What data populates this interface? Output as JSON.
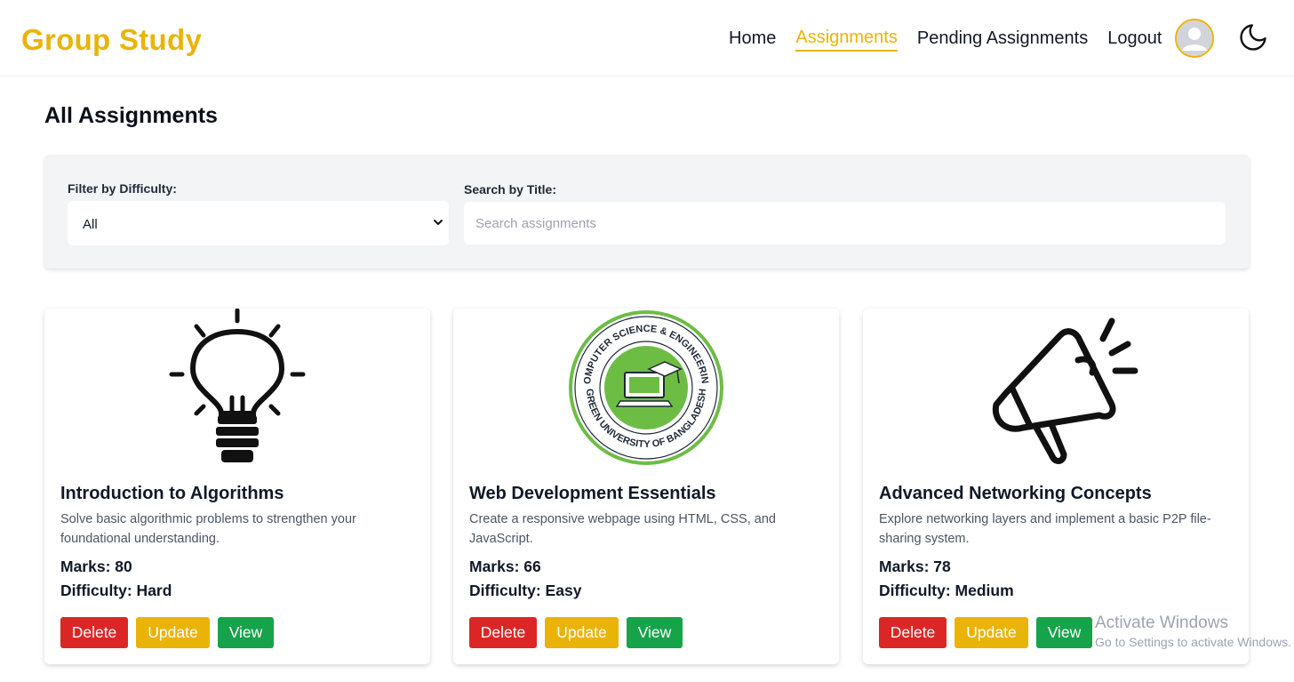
{
  "brand": "Group Study",
  "nav": {
    "home": "Home",
    "assignments": "Assignments",
    "pending": "Pending Assignments",
    "logout": "Logout"
  },
  "page_title": "All Assignments",
  "filters": {
    "difficulty_label": "Filter by Difficulty:",
    "difficulty_value": "All",
    "search_label": "Search by Title:",
    "search_placeholder": "Search assignments",
    "search_value": ""
  },
  "cards": [
    {
      "image_icon": "lightbulb-icon",
      "title": "Introduction to Algorithms",
      "description": "Solve basic algorithmic problems to strengthen your foundational understanding.",
      "marks": "Marks: 80",
      "difficulty": "Difficulty: Hard",
      "delete_label": "Delete",
      "update_label": "Update",
      "view_label": "View"
    },
    {
      "image_icon": "university-logo",
      "logo_top_text": "COMPUTER SCIENCE & ENGINEERING",
      "logo_bottom_text": "GREEN UNIVERSITY OF BANGLADESH",
      "title": "Web Development Essentials",
      "description": "Create a responsive webpage using HTML, CSS, and JavaScript.",
      "marks": "Marks: 66",
      "difficulty": "Difficulty: Easy",
      "delete_label": "Delete",
      "update_label": "Update",
      "view_label": "View"
    },
    {
      "image_icon": "megaphone-icon",
      "title": "Advanced Networking Concepts",
      "description": "Explore networking layers and implement a basic P2P file-sharing system.",
      "marks": "Marks: 78",
      "difficulty": "Difficulty: Medium",
      "delete_label": "Delete",
      "update_label": "Update",
      "view_label": "View"
    }
  ],
  "watermark": {
    "title": "Activate Windows",
    "subtitle": "Go to Settings to activate Windows."
  },
  "colors": {
    "accent": "#eab308",
    "delete": "#dc2626",
    "update": "#eab308",
    "view": "#16a34a",
    "logo_green": "#6dbd45"
  }
}
